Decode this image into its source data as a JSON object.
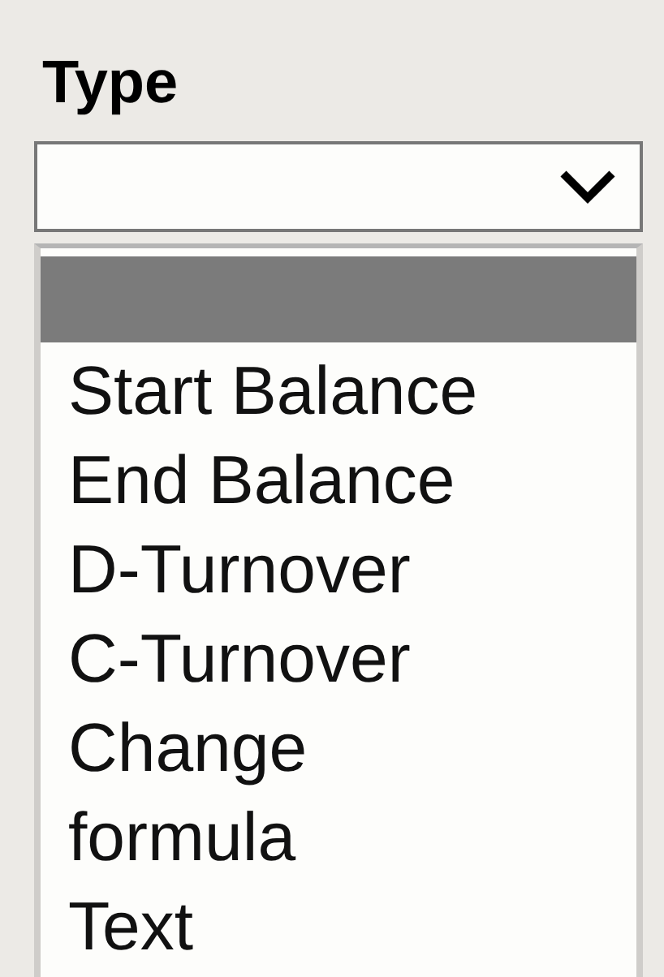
{
  "field": {
    "label": "Type"
  },
  "dropdown": {
    "expanded": true,
    "blank_option": {
      "selected": true
    },
    "options": [
      {
        "label": "Start Balance",
        "selected": false
      },
      {
        "label": "End Balance",
        "selected": false
      },
      {
        "label": "D-Turnover",
        "selected": false
      },
      {
        "label": "C-Turnover",
        "selected": false
      },
      {
        "label": "Change",
        "selected": false
      },
      {
        "label": "formula",
        "selected": false
      },
      {
        "label": "Text",
        "selected": false
      }
    ]
  }
}
